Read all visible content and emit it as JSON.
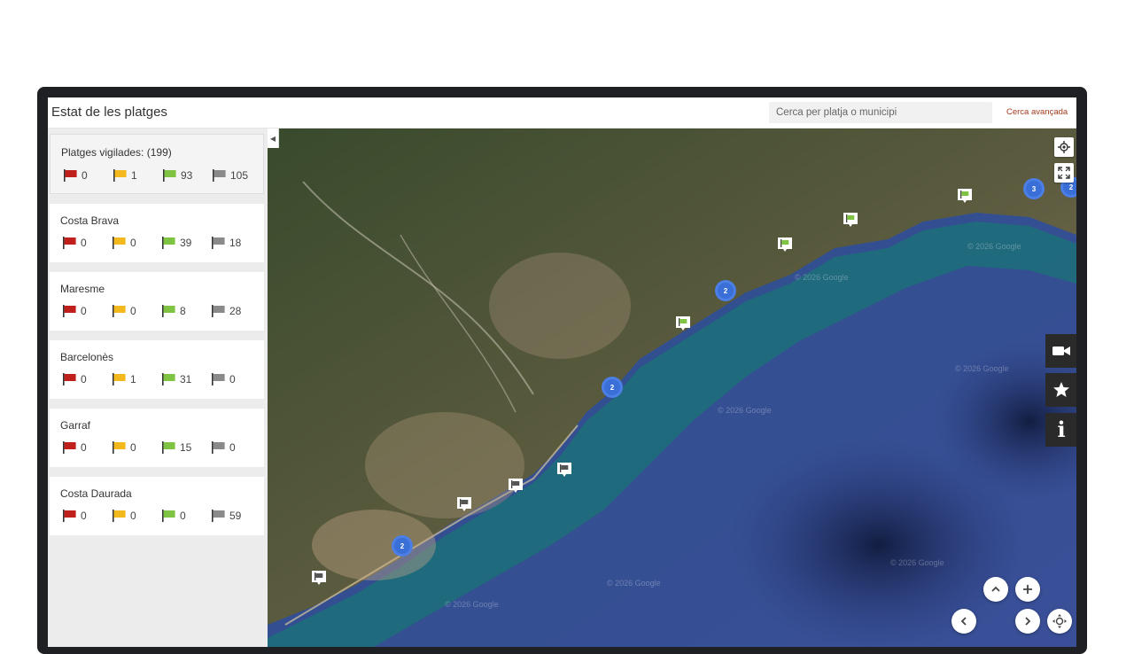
{
  "header": {
    "title": "Estat de les platges",
    "search_placeholder": "Cerca per platja o municipi",
    "advanced_search": "Cerca avançada"
  },
  "flag_colors": {
    "red": "#c0201c",
    "yellow": "#f2b81c",
    "green": "#7fc342",
    "grey": "#8a8a8a"
  },
  "summary": {
    "title": "Platges vigilades: (199)",
    "counts": {
      "red": "0",
      "yellow": "1",
      "green": "93",
      "grey": "105"
    }
  },
  "regions": [
    {
      "name": "Costa Brava",
      "counts": {
        "red": "0",
        "yellow": "0",
        "green": "39",
        "grey": "18"
      }
    },
    {
      "name": "Maresme",
      "counts": {
        "red": "0",
        "yellow": "0",
        "green": "8",
        "grey": "28"
      }
    },
    {
      "name": "Barcelonès",
      "counts": {
        "red": "0",
        "yellow": "1",
        "green": "31",
        "grey": "0"
      }
    },
    {
      "name": "Garraf",
      "counts": {
        "red": "0",
        "yellow": "0",
        "green": "15",
        "grey": "0"
      }
    },
    {
      "name": "Costa Daurada",
      "counts": {
        "red": "0",
        "yellow": "0",
        "green": "0",
        "grey": "59"
      }
    }
  ],
  "map": {
    "clusters": [
      "2",
      "2",
      "2",
      "3",
      "2"
    ],
    "watermark": "© 2026 Google",
    "marker_types": [
      "green",
      "green",
      "green",
      "green",
      "white",
      "white",
      "white",
      "white"
    ]
  },
  "icons": {
    "collapse": "collapse-left-icon",
    "locate": "locate-icon",
    "fullscreen": "fullscreen-icon",
    "camera": "video-camera-icon",
    "star": "star-icon",
    "info": "info-icon",
    "up": "chevron-up-icon",
    "zoom_in": "plus-icon",
    "left": "chevron-left-icon",
    "right": "chevron-right-icon",
    "move": "move-icon"
  }
}
